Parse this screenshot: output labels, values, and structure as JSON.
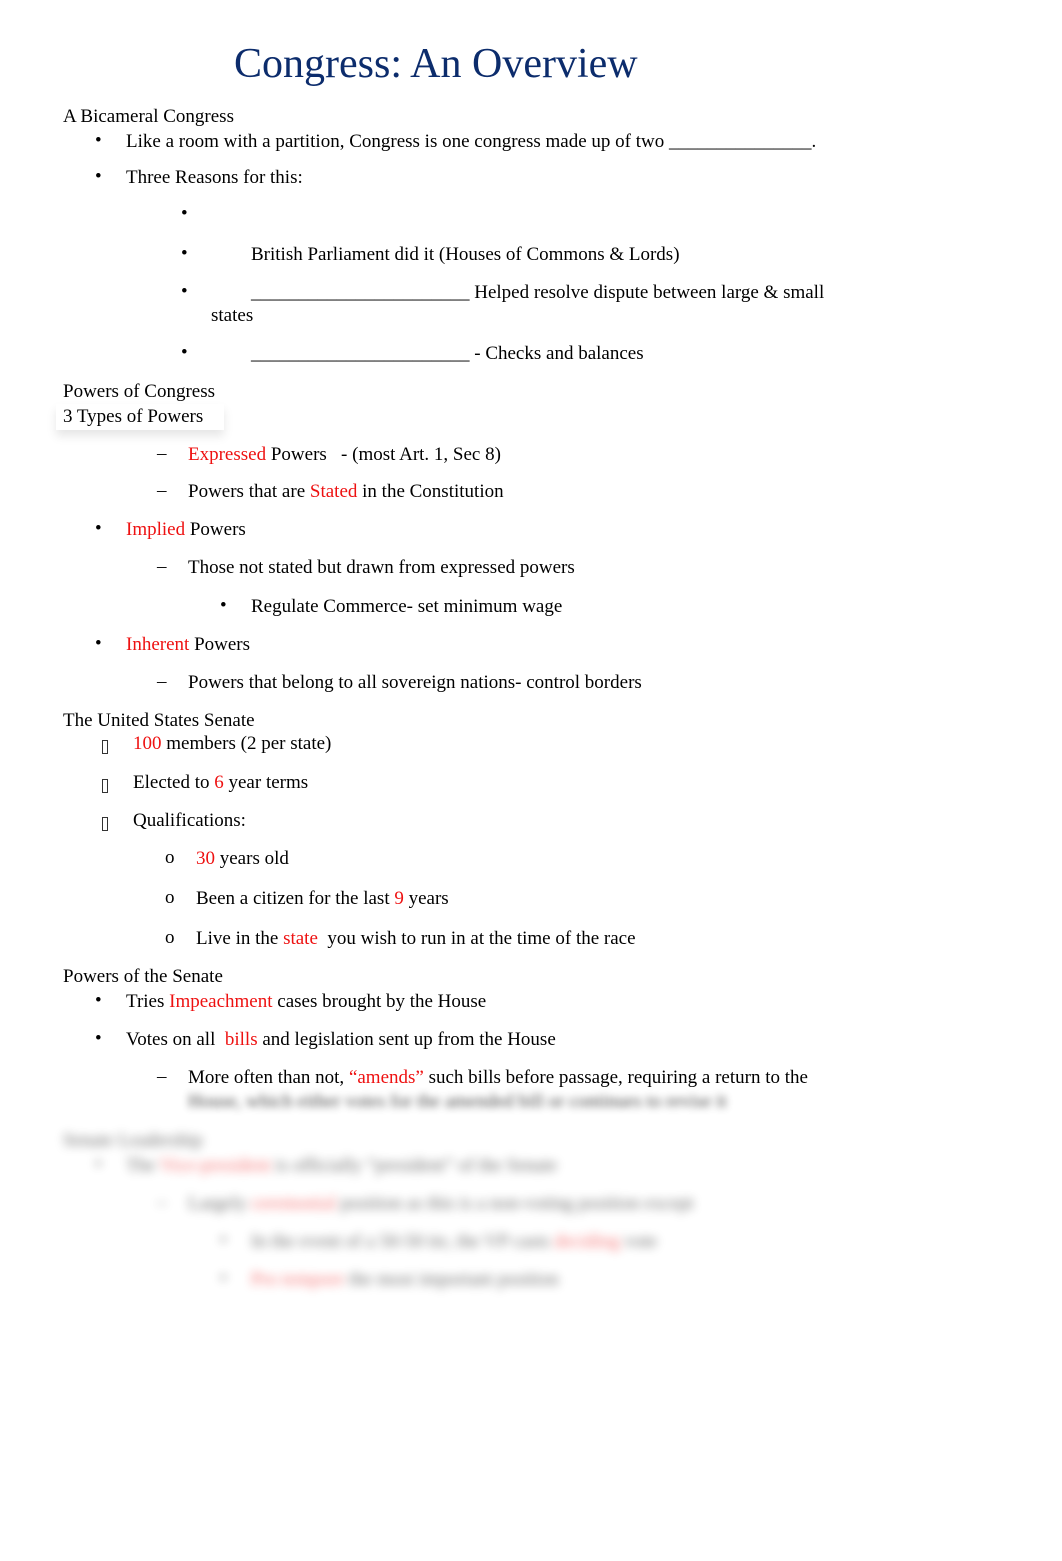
{
  "title": "Congress: An Overview",
  "colors": {
    "title": "#0c2c6c",
    "highlight": "#ee1111",
    "text": "#000000"
  },
  "sections": {
    "bicameral": {
      "heading": "A Bicameral Congress",
      "items": [
        {
          "bullet": "•",
          "pre": "Like a room with a partition, Congress is one congress made up of two ",
          "blank": "_______________",
          "post": "."
        },
        {
          "bullet": "•",
          "text": "Three Reasons for this:"
        }
      ],
      "reasons": [
        {
          "bullet": "•",
          "text": ""
        },
        {
          "bullet": "•",
          "text": "British Parliament did it (Houses of Commons & Lords)"
        },
        {
          "bullet": "•",
          "blank": "_______________________",
          "text": " Helped resolve dispute between large & small",
          "wrap": "states"
        },
        {
          "bullet": "•",
          "blank": "_______________________",
          "text": " - Checks and balances"
        }
      ]
    },
    "powers": {
      "heading": "Powers of Congress",
      "subheading": "3 Types of Powers",
      "expressed": {
        "dash": "–",
        "red": "Expressed",
        "text": " Powers   - (most Art. 1, Sec 8)"
      },
      "expressed_def": {
        "dash": "–",
        "pre": "Powers that are ",
        "red": "Stated",
        "post": " in the Constitution"
      },
      "implied": {
        "bullet": "•",
        "red": "Implied",
        "text": " Powers"
      },
      "implied_def": {
        "dash": "–",
        "text": "Those not stated but drawn from expressed powers"
      },
      "implied_example": {
        "bullet": "•",
        "text": "Regulate Commerce- set minimum wage"
      },
      "inherent": {
        "bullet": "•",
        "red": "Inherent",
        "text": " Powers"
      },
      "inherent_def": {
        "dash": "–",
        "text": "Powers that belong to all sovereign nations- control borders"
      }
    },
    "senate": {
      "heading": "The United States Senate",
      "items": [
        {
          "red": "100",
          "post": " members (2 per state)"
        },
        {
          "pre": "Elected to ",
          "red": "6",
          "post": " year terms"
        },
        {
          "pre": "Qualifications:"
        }
      ],
      "qualifications": [
        {
          "bullet": "o",
          "red": "30",
          "post": " years old"
        },
        {
          "bullet": "o",
          "pre": "Been a citizen for the last ",
          "red": "9",
          "post": " years"
        },
        {
          "bullet": "o",
          "pre": "Live in the ",
          "red": "state",
          "post": "  you wish to run in at the time of the race"
        }
      ]
    },
    "senate_powers": {
      "heading": "Powers of the Senate",
      "items": [
        {
          "bullet": "•",
          "pre": "Tries ",
          "red": "Impeachment",
          "post": " cases brought by the House"
        },
        {
          "bullet": "•",
          "pre": "Votes on all  ",
          "red": "bills",
          "post": " and legislation sent up from the House"
        }
      ],
      "amends": {
        "dash": "–",
        "pre": "More often than not, ",
        "red": "“amends”",
        "post": " such bills before passage, requiring a return to the"
      },
      "amends_wrap_blurred": "House, which either votes for the amended bill or continues to revise it"
    },
    "leadership_blurred": {
      "heading": "Senate Leadership",
      "vp": {
        "bullet": "•",
        "pre": "The ",
        "red": "Vice-president",
        "post": " is officially “president” of the Senate"
      },
      "ceremonial": {
        "dash": "–",
        "pre": "Largely ",
        "red": "ceremonial",
        "post": " position as this is a non-voting position except"
      },
      "tie": {
        "bullet": "•",
        "pre": "In the event of a 50-50 tie, the VP casts ",
        "red": "deciding",
        "post": " vote"
      },
      "pro_tem": {
        "bullet": "•",
        "red": "Pro tempore",
        "post": " the most important position"
      }
    }
  }
}
